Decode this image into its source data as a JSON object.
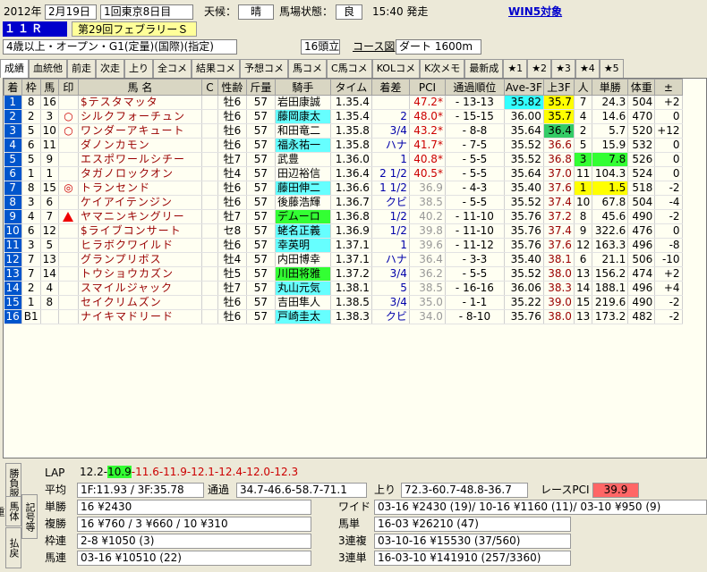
{
  "header": {
    "year": "2012年",
    "date": "2月19日",
    "meeting": "1回東京8日目",
    "weather_label": "天候：",
    "weather": "晴",
    "track_label": "馬場状態：",
    "track": "良",
    "post_time": "15:40 発走",
    "win5": "WIN5対象",
    "race_no": "１１Ｒ",
    "race_name": "第29回フェブラリーＳ",
    "conditions": "4歳以上・オープン・G1(定量)(国際)(指定)",
    "runners": "16頭立",
    "course_btn": "コース図",
    "course": "ダート 1600m"
  },
  "tabs": [
    "成績",
    "血統他",
    "前走",
    "次走",
    "上り",
    "全コメ",
    "結果コメ",
    "予想コメ",
    "馬コメ",
    "C馬コメ",
    "KOLコメ",
    "K次メモ",
    "最新成",
    "★1",
    "★2",
    "★3",
    "★4",
    "★5"
  ],
  "columns": [
    "着",
    "枠",
    "馬",
    "印",
    "馬 名",
    "C",
    "性齢",
    "斤量",
    "騎手",
    "タイム",
    "着差",
    "PCI",
    "通過順位",
    "Ave-3F",
    "上3F",
    "人",
    "単勝",
    "体重",
    "±"
  ],
  "rows": [
    {
      "fin": "1",
      "waku": "8",
      "uma": "16",
      "mark": "",
      "name": "$テスタマッタ",
      "c": "",
      "sa": "牡6",
      "kin": "57",
      "jockey": "岩田康誠",
      "time": "1.35.4",
      "diff": "",
      "pci": "47.2*",
      "pass": "- 13-13",
      "ave": "35.82",
      "up": "35.7",
      "pop": "7",
      "odds": "24.3",
      "wt": "504",
      "pm": "+2"
    },
    {
      "fin": "2",
      "waku": "2",
      "uma": "3",
      "mark": "○",
      "name": "シルクフォーチュン",
      "c": "",
      "sa": "牡6",
      "kin": "57",
      "jockey": "藤岡康太",
      "time": "1.35.4",
      "diff": "2",
      "pci": "48.0*",
      "pass": "- 15-15",
      "ave": "36.00",
      "up": "35.7",
      "pop": "4",
      "odds": "14.6",
      "wt": "470",
      "pm": "0"
    },
    {
      "fin": "3",
      "waku": "5",
      "uma": "10",
      "mark": "○",
      "name": "ワンダーアキュート",
      "c": "",
      "sa": "牡6",
      "kin": "57",
      "jockey": "和田竜二",
      "time": "1.35.8",
      "diff": "3/4",
      "pci": "43.2*",
      "pass": "- 8-8",
      "ave": "35.64",
      "up": "36.4",
      "pop": "2",
      "odds": "5.7",
      "wt": "520",
      "pm": "+12"
    },
    {
      "fin": "4",
      "waku": "6",
      "uma": "11",
      "mark": "",
      "name": "ダノンカモン",
      "c": "",
      "sa": "牡6",
      "kin": "57",
      "jockey": "福永祐一",
      "time": "1.35.8",
      "diff": "ハナ",
      "pci": "41.7*",
      "pass": "- 7-5",
      "ave": "35.52",
      "up": "36.6",
      "pop": "5",
      "odds": "15.9",
      "wt": "532",
      "pm": "0"
    },
    {
      "fin": "5",
      "waku": "5",
      "uma": "9",
      "mark": "",
      "name": "エスポワールシチー",
      "c": "",
      "sa": "牡7",
      "kin": "57",
      "jockey": "武豊",
      "time": "1.36.0",
      "diff": "1",
      "pci": "40.8*",
      "pass": "- 5-5",
      "ave": "35.52",
      "up": "36.8",
      "pop": "3",
      "odds": "7.8",
      "wt": "526",
      "pm": "0"
    },
    {
      "fin": "6",
      "waku": "1",
      "uma": "1",
      "mark": "",
      "name": "タガノロックオン",
      "c": "",
      "sa": "牡4",
      "kin": "57",
      "jockey": "田辺裕信",
      "time": "1.36.4",
      "diff": "2 1/2",
      "pci": "40.5*",
      "pass": "- 5-5",
      "ave": "35.64",
      "up": "37.0",
      "pop": "11",
      "odds": "104.3",
      "wt": "524",
      "pm": "0"
    },
    {
      "fin": "7",
      "waku": "8",
      "uma": "15",
      "mark": "◎",
      "name": "トランセンド",
      "c": "",
      "sa": "牡6",
      "kin": "57",
      "jockey": "藤田伸二",
      "time": "1.36.6",
      "diff": "1 1/2",
      "pci": "36.9",
      "pass": "- 4-3",
      "ave": "35.40",
      "up": "37.6",
      "pop": "1",
      "odds": "1.5",
      "wt": "518",
      "pm": "-2"
    },
    {
      "fin": "8",
      "waku": "3",
      "uma": "6",
      "mark": "",
      "name": "ケイアイテンジン",
      "c": "",
      "sa": "牡6",
      "kin": "57",
      "jockey": "後藤浩輝",
      "time": "1.36.7",
      "diff": "クビ",
      "pci": "38.5",
      "pass": "- 5-5",
      "ave": "35.52",
      "up": "37.4",
      "pop": "10",
      "odds": "67.8",
      "wt": "504",
      "pm": "-4"
    },
    {
      "fin": "9",
      "waku": "4",
      "uma": "7",
      "mark": "▲",
      "name": "ヤマニンキングリー",
      "c": "",
      "sa": "牡7",
      "kin": "57",
      "jockey": "デムーロ",
      "time": "1.36.8",
      "diff": "1/2",
      "pci": "40.2",
      "pass": "- 11-10",
      "ave": "35.76",
      "up": "37.2",
      "pop": "8",
      "odds": "45.6",
      "wt": "490",
      "pm": "-2"
    },
    {
      "fin": "10",
      "waku": "6",
      "uma": "12",
      "mark": "",
      "name": "$ライブコンサート",
      "c": "",
      "sa": "セ8",
      "kin": "57",
      "jockey": "蛯名正義",
      "time": "1.36.9",
      "diff": "1/2",
      "pci": "39.8",
      "pass": "- 11-10",
      "ave": "35.76",
      "up": "37.4",
      "pop": "9",
      "odds": "322.6",
      "wt": "476",
      "pm": "0"
    },
    {
      "fin": "11",
      "waku": "3",
      "uma": "5",
      "mark": "",
      "name": "ヒラボクワイルド",
      "c": "",
      "sa": "牡6",
      "kin": "57",
      "jockey": "幸英明",
      "time": "1.37.1",
      "diff": "1",
      "pci": "39.6",
      "pass": "- 11-12",
      "ave": "35.76",
      "up": "37.6",
      "pop": "12",
      "odds": "163.3",
      "wt": "496",
      "pm": "-8"
    },
    {
      "fin": "12",
      "waku": "7",
      "uma": "13",
      "mark": "",
      "name": "グランプリボス",
      "c": "",
      "sa": "牡4",
      "kin": "57",
      "jockey": "内田博幸",
      "time": "1.37.1",
      "diff": "ハナ",
      "pci": "36.4",
      "pass": "- 3-3",
      "ave": "35.40",
      "up": "38.1",
      "pop": "6",
      "odds": "21.1",
      "wt": "506",
      "pm": "-10"
    },
    {
      "fin": "13",
      "waku": "7",
      "uma": "14",
      "mark": "",
      "name": "トウショウカズン",
      "c": "",
      "sa": "牡5",
      "kin": "57",
      "jockey": "川田将雅",
      "time": "1.37.2",
      "diff": "3/4",
      "pci": "36.2",
      "pass": "- 5-5",
      "ave": "35.52",
      "up": "38.0",
      "pop": "13",
      "odds": "156.2",
      "wt": "474",
      "pm": "+2"
    },
    {
      "fin": "14",
      "waku": "2",
      "uma": "4",
      "mark": "",
      "name": "スマイルジャック",
      "c": "",
      "sa": "牡7",
      "kin": "57",
      "jockey": "丸山元気",
      "time": "1.38.1",
      "diff": "5",
      "pci": "38.5",
      "pass": "- 16-16",
      "ave": "36.06",
      "up": "38.3",
      "pop": "14",
      "odds": "188.1",
      "wt": "496",
      "pm": "+4"
    },
    {
      "fin": "15",
      "waku": "1",
      "uma": "8",
      "mark": "",
      "name": "セイクリムズン",
      "c": "",
      "sa": "牡6",
      "kin": "57",
      "jockey": "吉田隼人",
      "time": "1.38.5",
      "diff": "3/4",
      "pci": "35.0",
      "pass": "- 1-1",
      "ave": "35.22",
      "up": "39.0",
      "pop": "15",
      "odds": "219.6",
      "wt": "490",
      "pm": "-2"
    },
    {
      "fin": "16",
      "waku": "B1",
      "uma": "",
      "mark": "",
      "name": "ナイキマドリード",
      "c": "",
      "sa": "牡6",
      "kin": "57",
      "jockey": "戸崎圭太",
      "time": "1.38.3",
      "diff": "クビ",
      "pci": "34.0",
      "pass": "- 8-10",
      "ave": "35.76",
      "up": "38.0",
      "pop": "13",
      "odds": "173.2",
      "wt": "482",
      "pm": "-2"
    }
  ],
  "lower": {
    "side_tabs": [
      "勝負服",
      "記号等",
      "馬体重",
      "払戻"
    ],
    "lap_label": "LAP",
    "lap_first": "12.2-",
    "lap_green": "10.9",
    "lap_rest": "-11.6-11.9-12.1-12.4-12.0-12.3",
    "avg_label": "平均",
    "avg": "1F:11.93 / 3F:35.78",
    "pass_label": "通過",
    "pass": "34.7-46.6-58.7-71.1",
    "agari_label": "上り",
    "agari": "72.3-60.7-48.8-36.7",
    "race_pci_label": "レースPCI",
    "race_pci": "39.9",
    "tansho_label": "単勝",
    "tansho": "16 ¥2430",
    "fukusho_label": "複勝",
    "fukusho": "16 ¥760 / 3 ¥660 / 10 ¥310",
    "wakuren_label": "枠連",
    "wakuren": "2-8 ¥1050 (3)",
    "umaren_label": "馬連",
    "umaren": "03-16 ¥10510 (22)",
    "wide_label": "ワイド",
    "wide": "03-16 ¥2430 (19)/ 10-16 ¥1160 (11)/ 03-10 ¥950 (9)",
    "umatan_label": "馬単",
    "umatan": "16-03 ¥26210 (47)",
    "sanrenpuku_label": "3連複",
    "sanrenpuku": "03-10-16 ¥15530 (37/560)",
    "sanrentan_label": "3連単",
    "sanrentan": "16-03-10 ¥141910 (257/3360)"
  }
}
